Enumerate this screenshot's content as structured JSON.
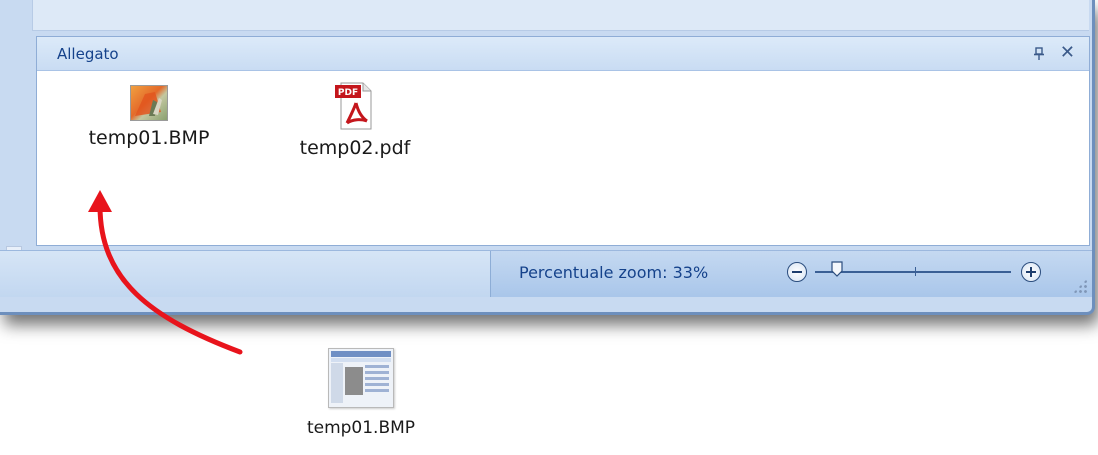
{
  "pane": {
    "title": "Allegato",
    "pin_icon": "pin-icon",
    "close_label": "✕"
  },
  "attachments": [
    {
      "name": "temp01.BMP",
      "icon": "bitmap-file-icon"
    },
    {
      "name": "temp02.pdf",
      "icon": "pdf-file-icon",
      "badge": "PDF"
    }
  ],
  "status_bar": {
    "zoom_label": "Percentuale zoom:",
    "zoom_value": "33%",
    "zoom_fraction": 0.33
  },
  "desktop": {
    "file_name": "temp01.BMP",
    "icon": "bitmap-thumbnail-icon"
  },
  "colors": {
    "arrow": "#e8141c",
    "pane_title": "#15428b",
    "pdf_red": "#c4161c"
  }
}
